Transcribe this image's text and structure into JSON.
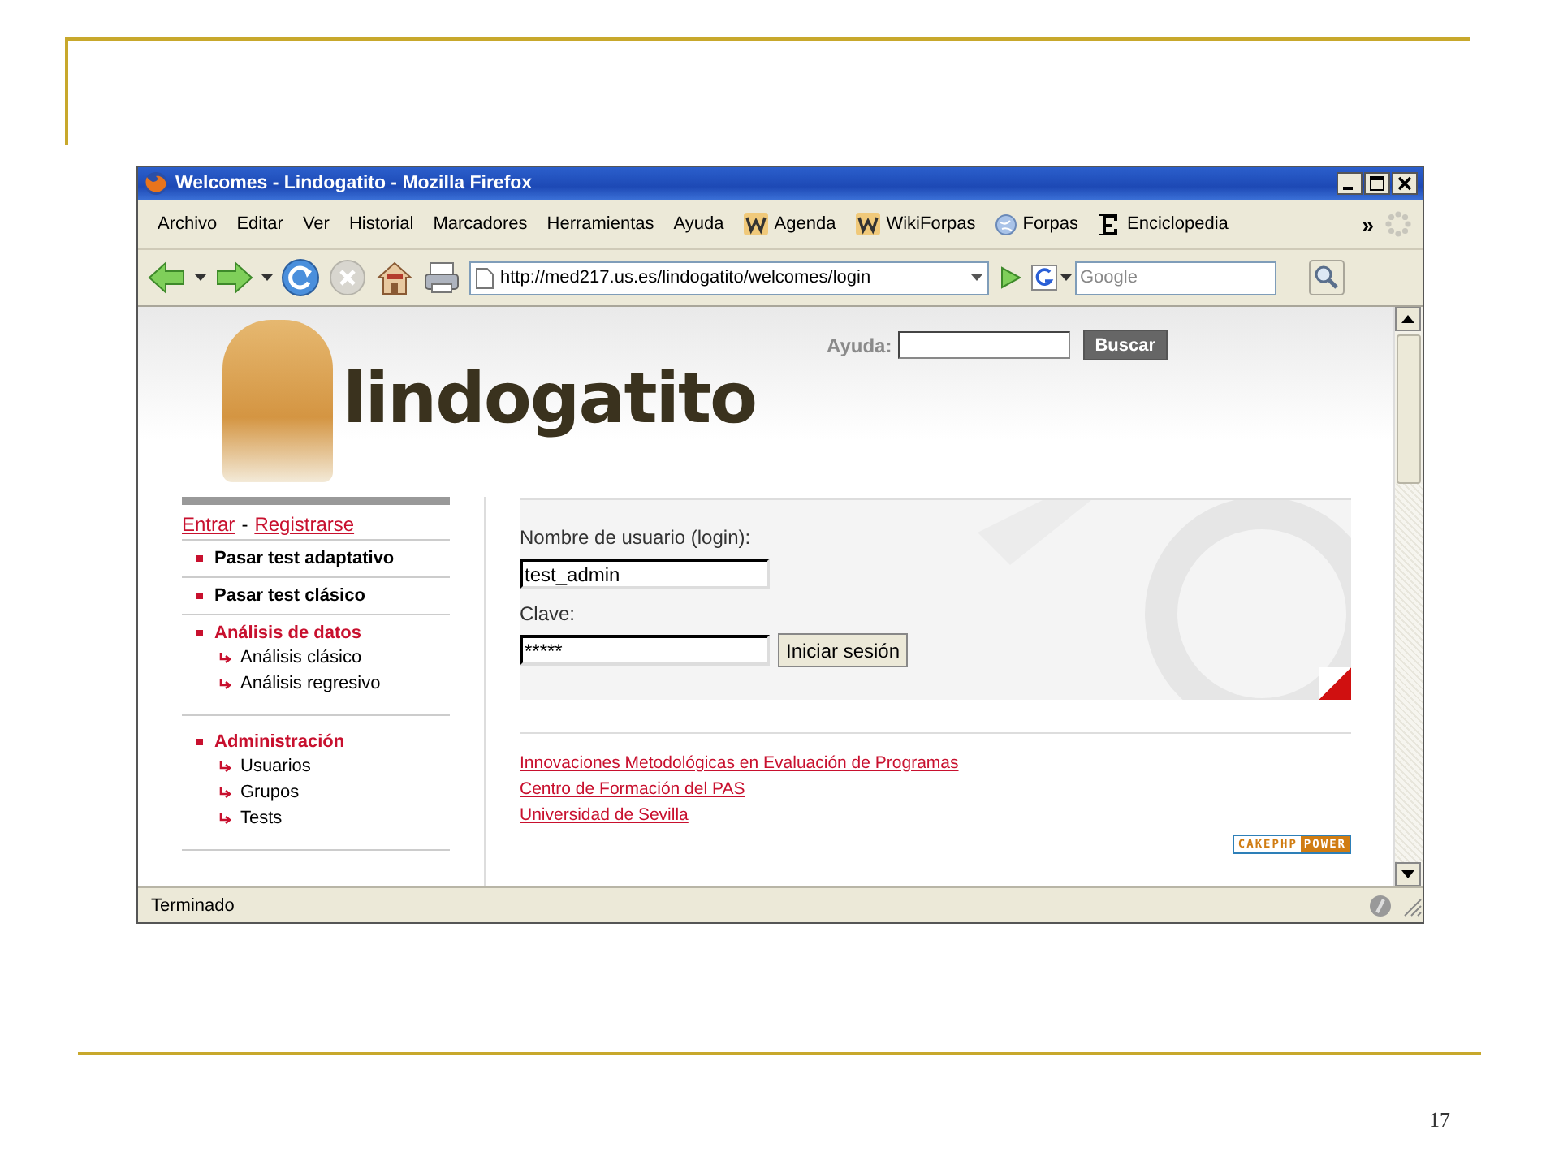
{
  "slide": {
    "page_number": "17"
  },
  "window": {
    "title": "Welcomes - Lindogatito - Mozilla Firefox"
  },
  "menu_bar": [
    {
      "label": "Archivo",
      "kind": "menu"
    },
    {
      "label": "Editar",
      "kind": "menu"
    },
    {
      "label": "Ver",
      "kind": "menu"
    },
    {
      "label": "Historial",
      "kind": "menu"
    },
    {
      "label": "Marcadores",
      "kind": "menu"
    },
    {
      "label": "Herramientas",
      "kind": "menu"
    },
    {
      "label": "Ayuda",
      "kind": "menu"
    },
    {
      "label": "Agenda",
      "kind": "bookmark-w"
    },
    {
      "label": "WikiForpas",
      "kind": "bookmark-w"
    },
    {
      "label": "Forpas",
      "kind": "bookmark-globe"
    },
    {
      "label": "Enciclopedia",
      "kind": "bookmark-e"
    }
  ],
  "menu_overflow": "»",
  "address_bar": {
    "value": "http://med217.us.es/lindogatito/welcomes/login"
  },
  "search_bar": {
    "placeholder": "Google"
  },
  "page": {
    "logo_text": "lindogatito",
    "help_search": {
      "label": "Ayuda:",
      "button": "Buscar"
    },
    "auth": {
      "login_link": "Entrar",
      "separator": "-",
      "register_link": "Registrarse"
    },
    "nav": [
      {
        "label": "Pasar test adaptativo",
        "expanded": false
      },
      {
        "label": "Pasar test clásico",
        "expanded": false
      },
      {
        "label": "Análisis de datos",
        "expanded": true,
        "children": [
          {
            "label": "Análisis clásico"
          },
          {
            "label": "Análisis regresivo"
          }
        ]
      },
      {
        "label": "Administración",
        "expanded": true,
        "children": [
          {
            "label": "Usuarios"
          },
          {
            "label": "Grupos"
          },
          {
            "label": "Tests"
          }
        ]
      }
    ],
    "login": {
      "username_label": "Nombre de usuario (login):",
      "username_value": "test_admin",
      "password_label": "Clave:",
      "password_value": "*****",
      "submit": "Iniciar sesión"
    },
    "links": [
      "Innovaciones Metodológicas en Evaluación de Programas",
      "Centro de Formación del PAS",
      "Universidad de Sevilla"
    ],
    "badge": {
      "left": "CAKEPHP",
      "right": "POWER"
    }
  },
  "status_bar": {
    "text": "Terminado"
  }
}
